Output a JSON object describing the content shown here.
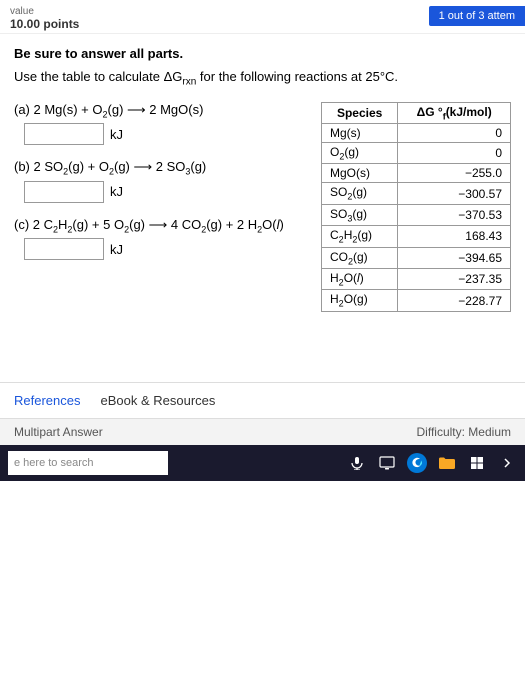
{
  "header": {
    "value_label": "value",
    "points_label": "10.00 points",
    "attempt_badge": "1 out of 3 attem"
  },
  "instruction": {
    "bold_text": "Be sure to answer all parts.",
    "use_table": "Use the table to calculate ΔG",
    "rxn_sub": "rxn",
    "use_table_suffix": " for the following reactions at 25°C."
  },
  "problems": [
    {
      "id": "a",
      "label": "(a) 2 Mg(s) + O₂(g) → 2 MgO(s)",
      "unit": "kJ"
    },
    {
      "id": "b",
      "label": "(b) 2 SO₂(g) + O₂(g) → 2 SO₃(g)",
      "unit": "kJ"
    },
    {
      "id": "c",
      "label": "(c) 2 C₂H₂(g) + 5 O₂(g) → 4 CO₂(g) + 2 H₂O(l)",
      "unit": "kJ"
    }
  ],
  "reference_table": {
    "col1_header": "Species",
    "col2_header": "ΔG °f(kJ/mol)",
    "rows": [
      {
        "species": "Mg(s)",
        "value": "0"
      },
      {
        "species": "O₂(g)",
        "value": "0"
      },
      {
        "species": "MgO(s)",
        "value": "−255.0"
      },
      {
        "species": "SO₂(g)",
        "value": "−300.57"
      },
      {
        "species": "SO₃(g)",
        "value": "−370.53"
      },
      {
        "species": "C₂H₂(g)",
        "value": "168.43"
      },
      {
        "species": "CO₂(g)",
        "value": "−394.65"
      },
      {
        "species": "H₂O(l)",
        "value": "−237.35"
      },
      {
        "species": "H₂O(g)",
        "value": "−228.77"
      }
    ]
  },
  "bottom_links": {
    "references": "References",
    "ebook": "eBook & Resources"
  },
  "footer": {
    "multipart": "Multipart Answer",
    "difficulty": "Difficulty: Medium"
  },
  "taskbar": {
    "search_placeholder": "e here to search"
  }
}
